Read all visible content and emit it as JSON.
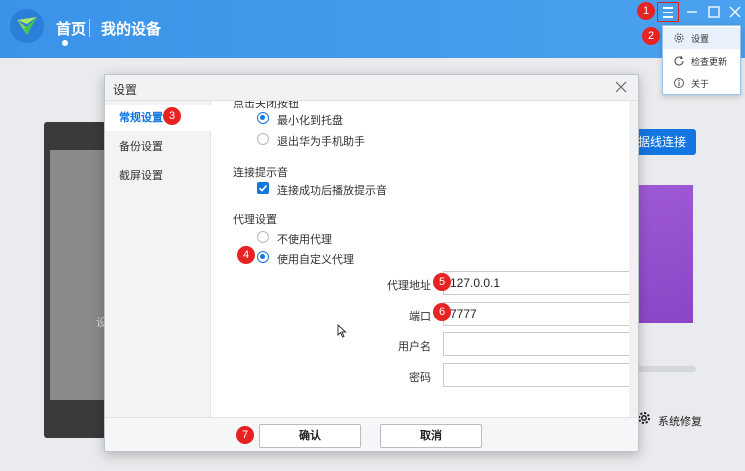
{
  "header": {
    "nav_home": "首页",
    "nav_devices": "我的设备"
  },
  "background": {
    "connect_button": "据线连接",
    "device_hint": "设",
    "system_repair": "系统修复"
  },
  "menu": {
    "items": [
      {
        "label": "设置",
        "icon": "gear-icon"
      },
      {
        "label": "检查更新",
        "icon": "refresh-icon"
      },
      {
        "label": "关于",
        "icon": "info-icon"
      }
    ]
  },
  "dialog": {
    "title": "设置",
    "sidebar": [
      {
        "label": "常规设置",
        "active": true
      },
      {
        "label": "备份设置",
        "active": false
      },
      {
        "label": "截屏设置",
        "active": false
      }
    ],
    "close_section": {
      "label": "点击关闭按钮",
      "options": [
        "最小化到托盘",
        "退出华为手机助手"
      ],
      "selected": 0
    },
    "sound_section": {
      "label": "连接提示音",
      "checkbox": "连接成功后播放提示音",
      "checked": true
    },
    "proxy_section": {
      "label": "代理设置",
      "options": [
        "不使用代理",
        "使用自定义代理"
      ],
      "selected": 1,
      "address_label": "代理地址",
      "address_value": "127.0.0.1",
      "port_label": "端口",
      "port_value": "7777",
      "user_label": "用户名",
      "user_value": "",
      "password_label": "密码",
      "password_value": ""
    },
    "confirm": "确认",
    "cancel": "取消"
  },
  "annotations": [
    "1",
    "2",
    "3",
    "4",
    "5",
    "6",
    "7"
  ],
  "colors": {
    "header_blue": "#3b93e8",
    "accent": "#1476e0",
    "badge_red": "#e62222",
    "purple": "#9a52d4"
  }
}
